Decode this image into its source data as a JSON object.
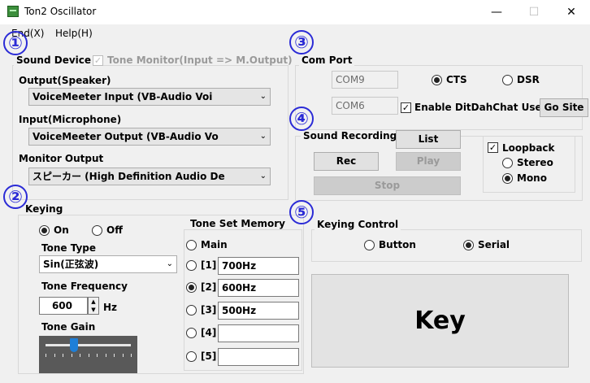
{
  "window": {
    "title": "Ton2 Oscillator",
    "minimize": "—",
    "maximize": "☐",
    "close": "✕"
  },
  "menu": {
    "end": "End(X)",
    "help": "Help(H)"
  },
  "markers": [
    "①",
    "②",
    "③",
    "④",
    "⑤"
  ],
  "sound_device": {
    "title": "Sound Device",
    "tone_monitor_label": "Tone Monitor(Input => M.Output)",
    "tone_monitor_checked": true,
    "output_label": "Output(Speaker)",
    "output_value": "VoiceMeeter Input (VB-Audio Voi",
    "input_label": "Input(Microphone)",
    "input_value": "VoiceMeeter Output (VB-Audio Vo",
    "monitor_label": "Monitor Output",
    "monitor_value": "スピーカー (High Definition Audio De"
  },
  "com_port": {
    "title": "Com Port",
    "port1": "COM9",
    "port2": "COM6",
    "cts_label": "CTS",
    "dsr_label": "DSR",
    "selected": "CTS",
    "enable_label": "Enable DitDahChat Use",
    "enable_checked": true,
    "go_site_label": "Go Site"
  },
  "sound_recording": {
    "title": "Sound Recording",
    "list_label": "List",
    "rec_label": "Rec",
    "play_label": "Play",
    "stop_label": "Stop",
    "loopback_label": "Loopback",
    "loopback_checked": true,
    "stereo_label": "Stereo",
    "mono_label": "Mono",
    "selected": "Mono"
  },
  "keying": {
    "title": "Keying",
    "on_label": "On",
    "off_label": "Off",
    "selected": "On",
    "tone_type_label": "Tone Type",
    "tone_type_value": "Sin(正弦波)",
    "tone_freq_label": "Tone Frequency",
    "tone_freq_value": "600",
    "tone_freq_unit": "Hz",
    "tone_gain_label": "Tone Gain",
    "tone_gain_level": 0.33
  },
  "tone_set_memory": {
    "title": "Tone Set Memory",
    "main_label": "Main",
    "items": [
      {
        "label": "[1]",
        "value": "700Hz"
      },
      {
        "label": "[2]",
        "value": "600Hz"
      },
      {
        "label": "[3]",
        "value": "500Hz"
      },
      {
        "label": "[4]",
        "value": ""
      },
      {
        "label": "[5]",
        "value": ""
      }
    ],
    "selected": "[2]"
  },
  "keying_control": {
    "title": "Keying Control",
    "button_label": "Button",
    "serial_label": "Serial",
    "selected": "Serial",
    "key_label": "Key"
  },
  "colors": {
    "marker": "#2b2bd6",
    "window_bg": "#f0f0f0",
    "slider_bg": "#595959",
    "slider_thumb": "#1e7fd8"
  }
}
